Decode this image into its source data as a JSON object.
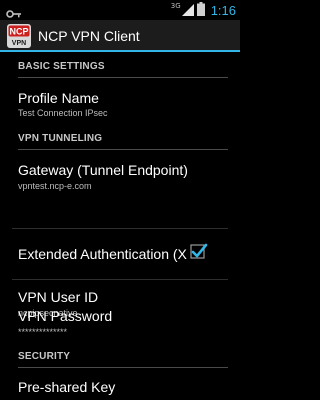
{
  "status_bar": {
    "network_type": "3G",
    "time": "1:16"
  },
  "action_bar": {
    "app_icon_text": "NCP VPN",
    "title": "NCP VPN Client"
  },
  "sections": {
    "basic_settings": "BASIC SETTINGS",
    "vpn_tunneling": "VPN TUNNELING",
    "security": "SECURITY"
  },
  "prefs": {
    "profile_name": {
      "title": "Profile Name",
      "summary": "Test Connection IPsec"
    },
    "gateway": {
      "title": "Gateway (Tunnel Endpoint)",
      "summary": "vpntest.ncp-e.com"
    },
    "extended_auth": {
      "title": "Extended Authentication (X",
      "checked": true
    },
    "vpn_user_id": {
      "title": "VPN User ID",
      "summary": "ncpipsecnative"
    },
    "vpn_password": {
      "title": "VPN Password",
      "summary": "**************"
    },
    "preshared_key": {
      "title": "Pre-shared Key"
    }
  },
  "colors": {
    "accent": "#33b5e5",
    "background": "#000000",
    "action_bar": "#1c1c1c"
  }
}
